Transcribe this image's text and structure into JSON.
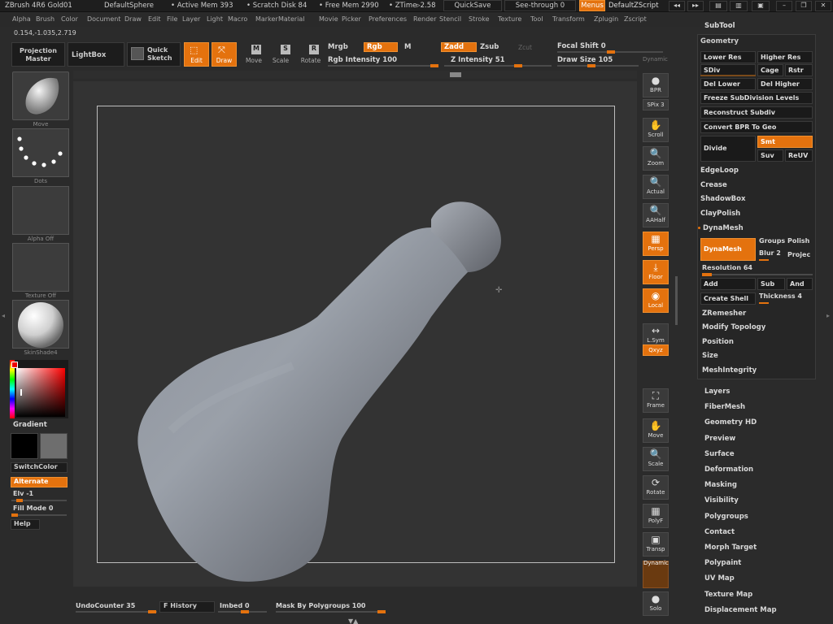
{
  "titlebar": {
    "app": "ZBrush 4R6 Gold01",
    "project": "DefaultSphere",
    "active_mem": "• Active Mem 393",
    "scratch": "• Scratch Disk 84",
    "free_mem": "• Free Mem 2990",
    "ztime": "• ZTime▹2.58",
    "quicksave": "QuickSave",
    "seethrough": "See-through  0",
    "menus": "Menus",
    "zscript": "DefaultZScript"
  },
  "menubar": [
    "Alpha",
    "Brush",
    "Color",
    "Document",
    "Draw",
    "Edit",
    "File",
    "Layer",
    "Light",
    "Macro",
    "Marker",
    "Material",
    "Movie",
    "Picker",
    "Preferences",
    "Render",
    "Stencil",
    "Stroke",
    "Texture",
    "Tool",
    "Transform",
    "Zplugin",
    "Zscript"
  ],
  "coords": "0.154,-1.035,2.719",
  "toolbar": {
    "projection_master": "Projection Master",
    "lightbox": "LightBox",
    "quick_sketch": "Quick Sketch",
    "edit": "Edit",
    "draw": "Draw",
    "move": "Move",
    "scale": "Scale",
    "rotate": "Rotate",
    "mrgb": "Mrgb",
    "rgb": "Rgb",
    "m": "M",
    "zadd": "Zadd",
    "zsub": "Zsub",
    "zcut": "Zcut",
    "rgb_intensity": "Rgb  Intensity 100",
    "z_intensity": "Z  Intensity 51",
    "focal_shift": "Focal Shift 0",
    "draw_size": "Draw  Size 105",
    "dynamic": "Dynamic"
  },
  "left": {
    "brush_label": "Move",
    "stroke_label": "Dots",
    "alpha_label": "Alpha  Off",
    "texture_label": "Texture  Off",
    "material_label": "SkinShade4",
    "gradient": "Gradient",
    "switchcolor": "SwitchColor",
    "alternate": "Alternate",
    "elv": "Elv -1",
    "fill_mode": "Fill Mode 0",
    "help": "Help"
  },
  "righttools": [
    {
      "label": "BPR",
      "icon": "●"
    },
    {
      "label": "SPix 3",
      "icon": ""
    },
    {
      "label": "Scroll",
      "icon": "✋"
    },
    {
      "label": "Zoom",
      "icon": "🔍"
    },
    {
      "label": "Actual",
      "icon": "🔍"
    },
    {
      "label": "AAHalf",
      "icon": "🔍"
    },
    {
      "label": "Persp",
      "icon": "▦"
    },
    {
      "label": "Floor",
      "icon": "⤓"
    },
    {
      "label": "Local",
      "icon": "◉"
    },
    {
      "label": "L.Sym",
      "icon": "↔"
    },
    {
      "label": "Qxyz",
      "icon": ""
    },
    {
      "label": "Frame",
      "icon": "⛶"
    },
    {
      "label": "Move",
      "icon": "✋"
    },
    {
      "label": "Scale",
      "icon": "🔍"
    },
    {
      "label": "Rotate",
      "icon": "⟳"
    },
    {
      "label": "PolyF",
      "icon": "▦"
    },
    {
      "label": "Transp",
      "icon": "▣"
    },
    {
      "label": "Dynamic",
      "icon": ""
    },
    {
      "label": "Solo",
      "icon": "●"
    }
  ],
  "bottombar": {
    "undo": "UndoCounter 35",
    "history": "F History",
    "imbed": "Imbed 0",
    "mask": "Mask By Polygroups 100"
  },
  "panel": {
    "subtool": "SubTool",
    "geometry": "Geometry",
    "lower_res": "Lower Res",
    "higher_res": "Higher Res",
    "sdiv": "SDiv",
    "cage": "Cage",
    "rstr": "Rstr",
    "del_lower": "Del Lower",
    "del_higher": "Del Higher",
    "freeze": "Freeze SubDivision Levels",
    "reconstruct": "Reconstruct Subdiv",
    "convert_bpr": "Convert BPR To Geo",
    "divide": "Divide",
    "smt": "Smt",
    "suv": "Suv",
    "reluv": "ReUV",
    "edgeloop": "EdgeLoop",
    "crease": "Crease",
    "shadowbox": "ShadowBox",
    "claypolish": "ClayPolish",
    "dynamesh_header": "DynaMesh",
    "dynamesh_btn": "DynaMesh",
    "groups": "Groups",
    "polish": "Polish",
    "blur": "Blur 2",
    "project": "Projec",
    "resolution": "Resolution 64",
    "add": "Add",
    "sub": "Sub",
    "and": "And",
    "create_shell": "Create Shell",
    "thickness": "Thickness 4",
    "zremesher": "ZRemesher",
    "modify_topology": "Modify Topology",
    "position": "Position",
    "size": "Size",
    "meshintegrity": "MeshIntegrity"
  },
  "toollist": [
    "Layers",
    "FiberMesh",
    "Geometry HD",
    "Preview",
    "Surface",
    "Deformation",
    "Masking",
    "Visibility",
    "Polygroups",
    "Contact",
    "Morph Target",
    "Polypaint",
    "UV Map",
    "Texture Map",
    "Displacement Map"
  ],
  "colors": {
    "accent": "#e4720e",
    "bg": "#2b2b2b",
    "viewport": "#333333"
  }
}
